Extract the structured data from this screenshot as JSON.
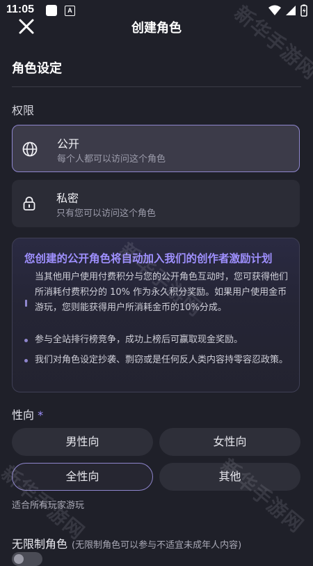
{
  "status_bar": {
    "time": "11:05",
    "notification_letter": "A"
  },
  "header": {
    "title": "创建角色"
  },
  "section": {
    "title": "角色设定"
  },
  "permission": {
    "label": "权限",
    "options": [
      {
        "title": "公开",
        "desc": "每个人都可以访问这个角色",
        "icon": "globe-icon",
        "selected": true
      },
      {
        "title": "私密",
        "desc": "只有您可以访问这个角色",
        "icon": "lock-icon",
        "selected": false
      }
    ]
  },
  "info": {
    "title": "您创建的公开角色将自动加入我们的创作者激励计划",
    "items": [
      "当其他用户使用付费积分与您的公开角色互动时，您可获得他们所消耗付费积分的 10% 作为永久积分奖励。如果用户使用金币游玩，您则能获得用户所消耗金币的10%分成。",
      "参与全站排行榜竞争，成功上榜后可赢取现金奖励。",
      "我们对角色设定抄袭、剽窃或是任何反人类内容持零容忍政策。"
    ]
  },
  "orientation": {
    "label": "性向",
    "required_mark": "*",
    "options": [
      "男性向",
      "女性向",
      "全性向",
      "其他"
    ],
    "selected": "全性向",
    "hint": "适合所有玩家游玩"
  },
  "unlimited": {
    "label": "无限制角色",
    "note": "(无限制角色可以参与不适宜未成年人内容)",
    "enabled": false
  },
  "watermark": {
    "text": "新华手游网"
  },
  "colors": {
    "background": "#1f2029",
    "accent": "#9f90ff",
    "selected_border": "#8f86ce"
  }
}
